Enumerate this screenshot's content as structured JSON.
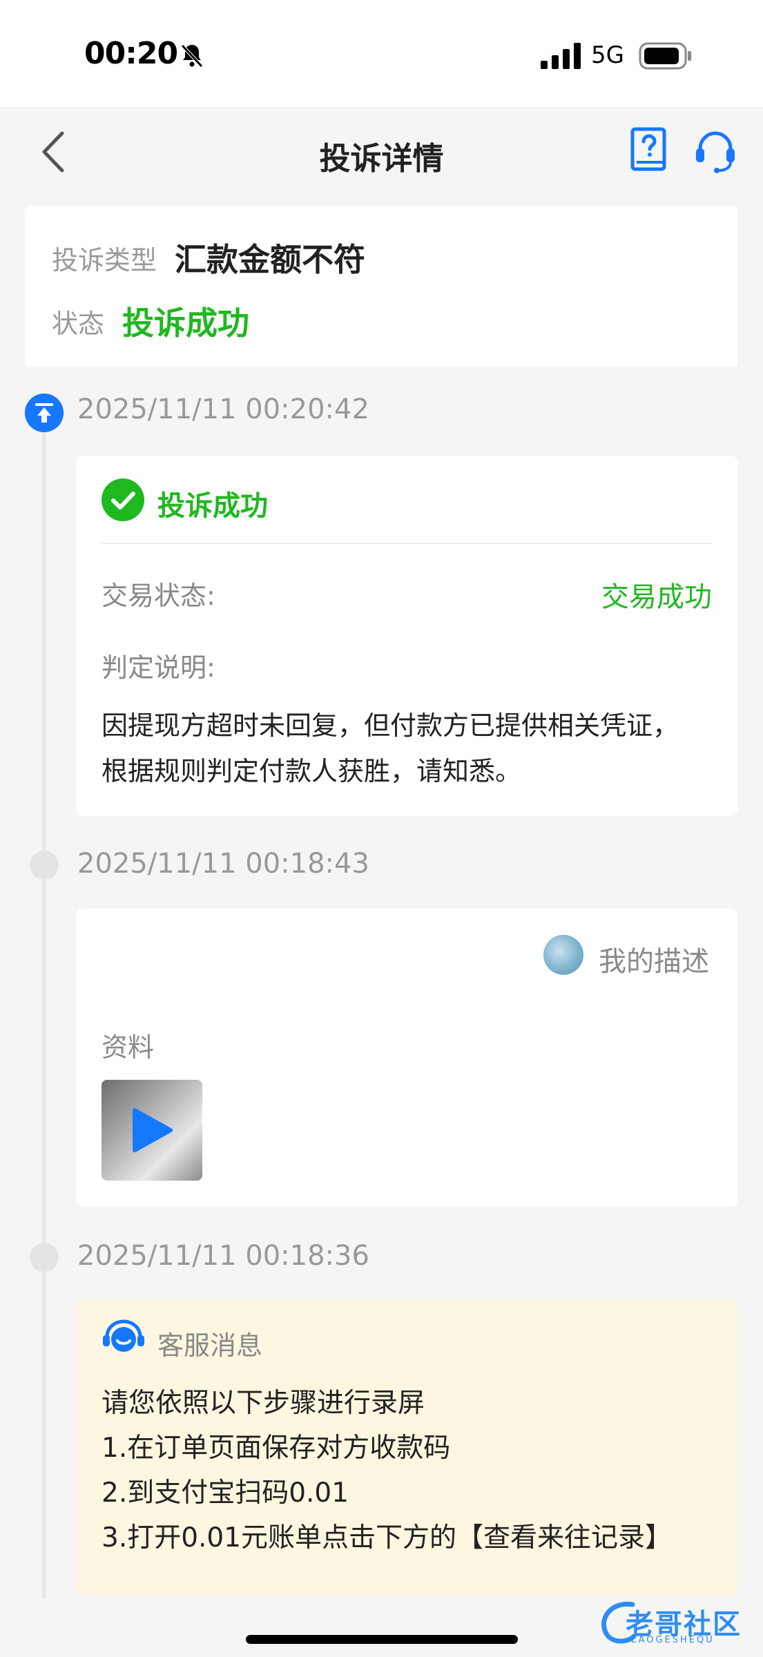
{
  "status_bar": {
    "time": "00:20",
    "network": "5G"
  },
  "nav": {
    "title": "投诉详情"
  },
  "summary": {
    "type_label": "投诉类型",
    "type_value": "汇款金额不符",
    "status_label": "状态",
    "status_value": "投诉成功"
  },
  "timeline": [
    {
      "time": "2025/11/11 00:20:42",
      "result_title": "投诉成功",
      "trade_label": "交易状态:",
      "trade_value": "交易成功",
      "verdict_label": "判定说明:",
      "verdict_text": "因提现方超时未回复，但付款方已提供相关凭证，根据规则判定付款人获胜，请知悉。"
    },
    {
      "time": "2025/11/11 00:18:43",
      "author": "我的描述",
      "attachment_label": "资料"
    },
    {
      "time": "2025/11/11 00:18:36",
      "title": "客服消息",
      "lines": [
        "请您依照以下步骤进行录屏",
        "1.在订单页面保存对方收款码",
        "2.到支付宝扫码0.01",
        "3.打开0.01元账单点击下方的【查看来往记录】"
      ]
    }
  ],
  "watermark": {
    "text": "老哥社区",
    "sub": "LAOGESHEQU"
  },
  "colors": {
    "accent_blue": "#1677ff",
    "success_green": "#1fb81f",
    "notice_bg": "#fdf6e0"
  },
  "icons": [
    "back-icon",
    "help-book-icon",
    "customer-service-icon",
    "bell-muted-icon",
    "signal-icon",
    "battery-icon",
    "check-circle-icon",
    "play-icon"
  ]
}
